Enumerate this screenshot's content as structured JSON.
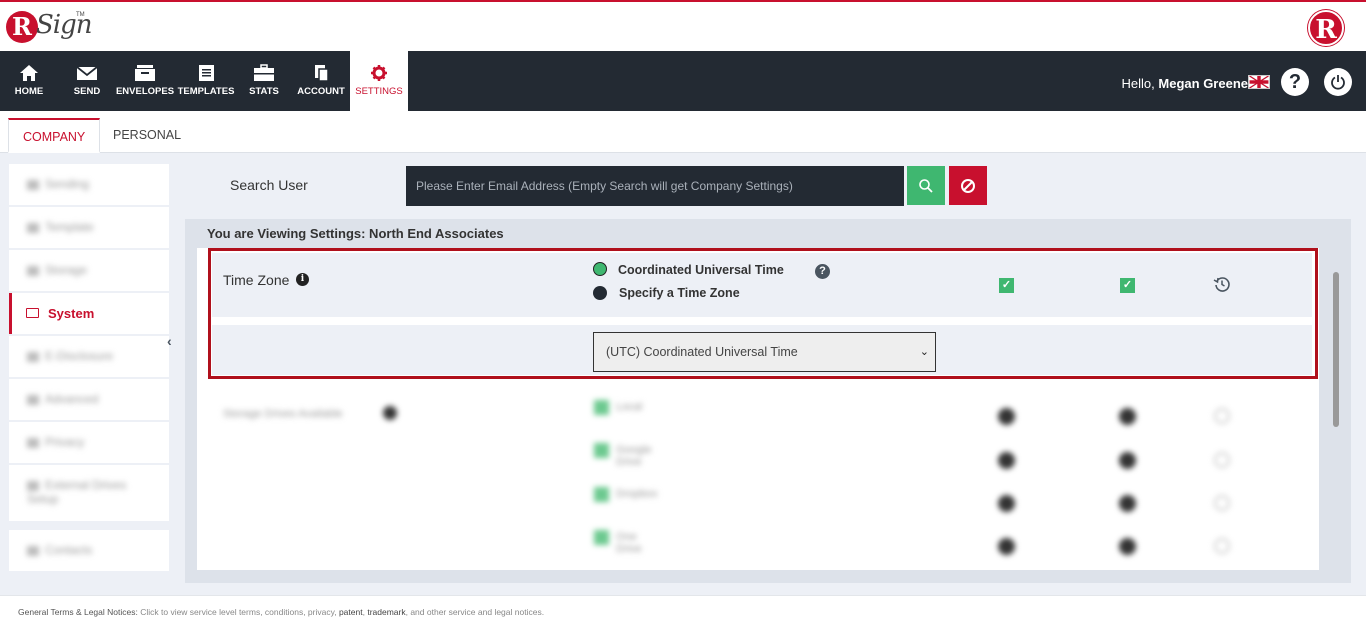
{
  "brand": {
    "logo_text": "Sign",
    "logo_letter": "R",
    "tm": "TM",
    "right_logo_letter": "R"
  },
  "nav": {
    "items": [
      {
        "label": "HOME",
        "icon": "home-icon"
      },
      {
        "label": "SEND",
        "icon": "envelope-icon"
      },
      {
        "label": "ENVELOPES",
        "icon": "envelopes-icon"
      },
      {
        "label": "TEMPLATES",
        "icon": "templates-icon"
      },
      {
        "label": "STATS",
        "icon": "briefcase-icon"
      },
      {
        "label": "ACCOUNT",
        "icon": "account-icon"
      },
      {
        "label": "SETTINGS",
        "icon": "gear-icon"
      }
    ],
    "greeting": "Hello,",
    "user_name": "Megan Greene",
    "help": "?",
    "accent": "#c8102e",
    "bg": "#232a33"
  },
  "tabs": {
    "company": "COMPANY",
    "personal": "PERSONAL"
  },
  "sidebar": {
    "items": [
      {
        "label": "Sending"
      },
      {
        "label": "Template"
      },
      {
        "label": "Storage"
      },
      {
        "label": "System"
      },
      {
        "label": "E-Disclosure"
      },
      {
        "label": "Advanced"
      },
      {
        "label": "Privacy"
      },
      {
        "label": "External Drives Setup"
      },
      {
        "label": "Contacts"
      }
    ],
    "active": "System"
  },
  "search": {
    "label": "Search User",
    "placeholder": "Please Enter Email Address (Empty Search will get Company Settings)"
  },
  "settings": {
    "viewing_title": "You are Viewing Settings: North End Associates",
    "time_zone": {
      "label": "Time Zone",
      "info": "i",
      "option_utc": "Coordinated Universal Time",
      "option_specify": "Specify a Time Zone",
      "help": "?",
      "selected_zone": "(UTC) Coordinated Universal Time"
    },
    "storage": {
      "label": "Storage Drives Available",
      "drives": [
        "Local",
        "Google Drive",
        "Dropbox",
        "One Drive"
      ]
    }
  },
  "footer": {
    "title": "General Terms & Legal Notices:",
    "text_1": "Click to view service level terms, conditions, privacy,",
    "patent": "patent",
    "comma": ",",
    "trademark": "trademark",
    "text_2": ", and other service and legal notices."
  }
}
